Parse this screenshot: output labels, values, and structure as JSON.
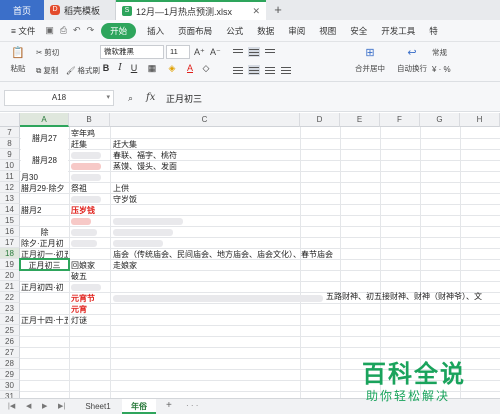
{
  "titlebar": {
    "home_tab": "首页",
    "template_tab": "稻壳模板",
    "file_tab": "12月—1月热点预测.xlsx",
    "new_tab": "+"
  },
  "menubar": {
    "file_menu": "≡ 文件",
    "start": "开始",
    "items": [
      "插入",
      "页面布局",
      "公式",
      "数据",
      "审阅",
      "视图",
      "安全",
      "开发工具",
      "特"
    ]
  },
  "ribbon": {
    "paste": "粘贴",
    "cut": "剪切",
    "copy": "复制",
    "format_painter": "格式刷",
    "font_name": "微软雅黑",
    "font_size": "11",
    "merge_center": "合并居中",
    "wrap": "自动换行",
    "number_format": "常规"
  },
  "formulabar": {
    "cell_ref": "A18",
    "fx": "fx",
    "content": "正月初三"
  },
  "columns": [
    "A",
    "B",
    "C",
    "D",
    "E",
    "F",
    "G",
    "H"
  ],
  "selected_column": "A",
  "rows": [
    "7",
    "8",
    "9",
    "10",
    "11",
    "12",
    "13",
    "14",
    "15",
    "16",
    "17",
    "18",
    "19",
    "20",
    "21",
    "22",
    "23",
    "24",
    "25",
    "26",
    "27",
    "28",
    "29",
    "30",
    "31"
  ],
  "selected_row": "18",
  "cells": {
    "a_chayue27": "腊月27",
    "a_chayue28": "腊月28",
    "a_chayue29": "腊月29·除夕",
    "a_chayue2x": "腊月2",
    "a_chu": "除",
    "a_chuxi_zhengyue": "除夕·正月初",
    "a_zhengyue_yi": "正月初一·初五",
    "a_zhengyue_san": "正月初三",
    "a_zhengyue_si": "正月初四·初",
    "a_zhengyue_14": "正月十四·十五",
    "a_yue30": "月30",
    "b_r7": "宰年鸡",
    "b_r8": "赶集",
    "b_r12": "祭祖",
    "b_r14": "压岁钱",
    "b_r18": "回娘家",
    "b_r19": "破五",
    "b_r21": "元宵节",
    "b_r22": "元宵",
    "b_r23": "灯谜",
    "c_r8": "赶大集",
    "c_r9": "春联、福字、桃符",
    "c_r10": "蒸馍、馒头、发面",
    "c_r12": "上供",
    "c_r13": "守岁饭",
    "c_r17": "庙会（传统庙会、民间庙会、地方庙会、庙会文化）、春节庙会",
    "c_r18": "走娘家",
    "c_r20": "五路财神、初五接财神、财神（财神爷）、文"
  },
  "sheets": [
    "Sheet1",
    "年俗"
  ],
  "active_sheet": "年俗",
  "watermark": {
    "logo": "百科全说",
    "tagline": "助你轻松解决"
  }
}
